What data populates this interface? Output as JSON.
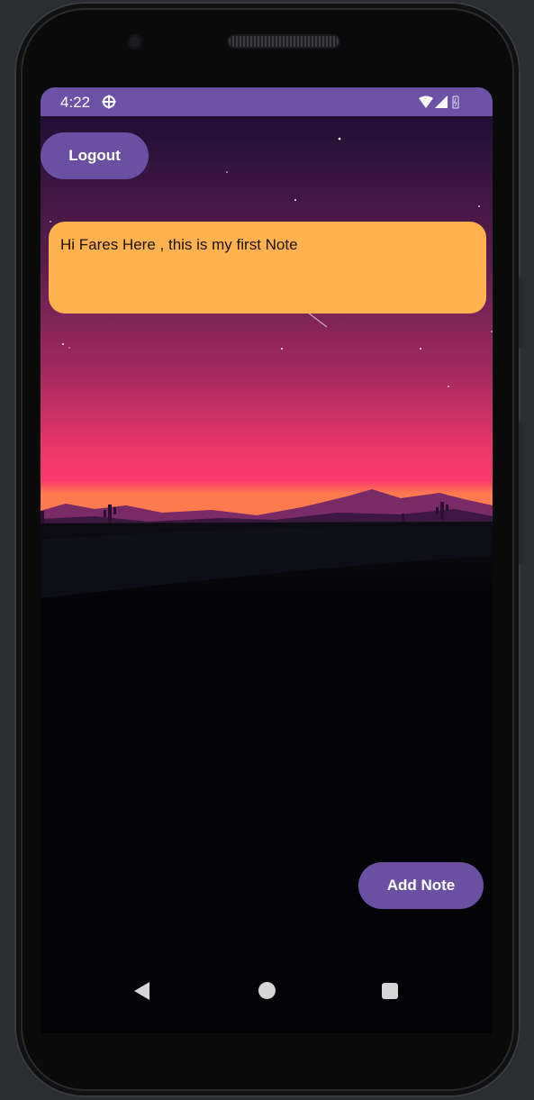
{
  "status_bar": {
    "time": "4:22",
    "icons": [
      "settings-gear-icon",
      "wifi-icon",
      "signal-icon",
      "battery-icon"
    ]
  },
  "header": {
    "logout_label": "Logout"
  },
  "notes": [
    {
      "text": "Hi Fares Here , this is my first Note"
    }
  ],
  "actions": {
    "add_note_label": "Add Note"
  },
  "navigation": {
    "buttons": [
      "back-icon",
      "home-icon",
      "recents-icon"
    ]
  },
  "colors": {
    "status_bar": "#6c51a6",
    "button": "#6b4fa3",
    "note_card": "#ffb24e",
    "sky_top": "#1f0f33",
    "sky_bottom": "#fb3a6b",
    "ground": "#030306"
  }
}
